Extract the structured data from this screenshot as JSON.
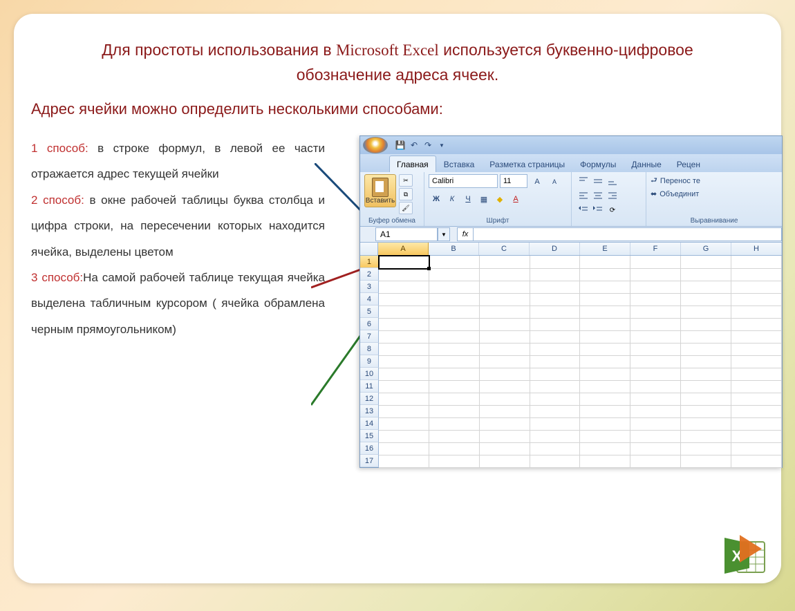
{
  "title": {
    "part1": "Для простоты использования в ",
    "brand": "Microsoft Excel",
    "part2": "  используется  буквенно-цифровое обозначение адреса  ячеек."
  },
  "subtitle": "Адрес ячейки можно определить несколькими способами:",
  "methods": {
    "m1_label": "1 способ:",
    "m1_text": " в строке формул, в левой ее части отражается адрес текущей ячейки",
    "m2_label": "2 способ:",
    "m2_text": "  в окне рабочей таблицы буква столбца и цифра строки, на пересечении которых находится ячейка,  выделены цветом",
    "m3_label": "3 способ:",
    "m3_text": "На самой рабочей таблице текущая ячейка выделена табличным курсором ( ячейка обрамлена черным прямоугольником)"
  },
  "excel": {
    "tabs": [
      "Главная",
      "Вставка",
      "Разметка страницы",
      "Формулы",
      "Данные",
      "Рецен"
    ],
    "active_tab": 0,
    "paste_label": "Вставить",
    "group_clipboard": "Буфер обмена",
    "group_font": "Шрифт",
    "group_align": "Выравнивание",
    "font_name": "Calibri",
    "font_size": "11",
    "wrap_text": "Перенос те",
    "merge_text": "Объединит",
    "name_box": "A1",
    "fx": "fx",
    "columns": [
      "A",
      "B",
      "C",
      "D",
      "E",
      "F",
      "G",
      "H"
    ],
    "rows": [
      "1",
      "2",
      "3",
      "4",
      "5",
      "6",
      "7",
      "8",
      "9",
      "10",
      "11",
      "12",
      "13",
      "14",
      "15",
      "16",
      "17"
    ],
    "selected_col": 0,
    "selected_row": 0
  }
}
